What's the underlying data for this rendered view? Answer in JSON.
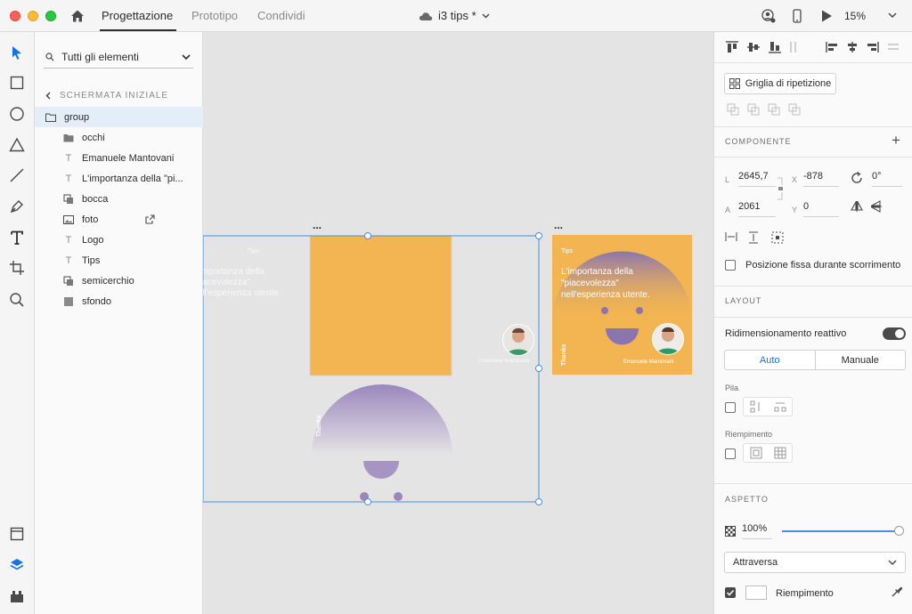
{
  "window": {
    "tabs": [
      {
        "label": "Progettazione",
        "active": true
      },
      {
        "label": "Prototipo",
        "active": false
      },
      {
        "label": "Condividi",
        "active": false
      }
    ],
    "document_title": "i3 tips *",
    "zoom": "15%"
  },
  "layers": {
    "search_label": "Tutti gli elementi",
    "breadcrumb": "SCHERMATA INIZIALE",
    "items": [
      {
        "label": "group",
        "icon": "folder-icon",
        "selected": true
      },
      {
        "label": "occhi",
        "icon": "folder-icon"
      },
      {
        "label": "Emanuele Mantovani",
        "icon": "text-icon"
      },
      {
        "label": "L'importanza della \"pi...",
        "icon": "text-icon"
      },
      {
        "label": "bocca",
        "icon": "mask-icon"
      },
      {
        "label": "foto",
        "icon": "image-icon"
      },
      {
        "label": "Logo",
        "icon": "text-icon"
      },
      {
        "label": "Tips",
        "icon": "text-icon"
      },
      {
        "label": "semicerchio",
        "icon": "mask-icon"
      },
      {
        "label": "sfondo",
        "icon": "rectangle-icon"
      }
    ]
  },
  "canvas": {
    "artboard_dots": "...",
    "card": {
      "tips": "Tips",
      "headline": "L'importanza della \"piacevolezza\" nell'esperienza utente.",
      "thanks": "Thanks",
      "author": "Emanuele Mantovani"
    },
    "colors": {
      "orange": "#f2b552",
      "purple": "#9b87bd",
      "selection": "#4a90e2"
    }
  },
  "properties": {
    "repeat_grid": "Griglia di ripetizione",
    "component_title": "COMPONENTE",
    "w_label": "L",
    "w_value": "2645,7",
    "h_label": "A",
    "h_value": "2061",
    "x_label": "X",
    "x_value": "-878",
    "y_label": "Y",
    "y_value": "0",
    "rotation": "0°",
    "fixed_position": "Posizione fissa durante scorrimento",
    "layout_title": "LAYOUT",
    "responsive_resize": "Ridimensionamento reattivo",
    "auto": "Auto",
    "manual": "Manuale",
    "stack": "Pila",
    "padding": "Riempimento",
    "appearance_title": "ASPETTO",
    "opacity": "100%",
    "blend_mode": "Attraversa",
    "fill_label": "Riempimento"
  }
}
